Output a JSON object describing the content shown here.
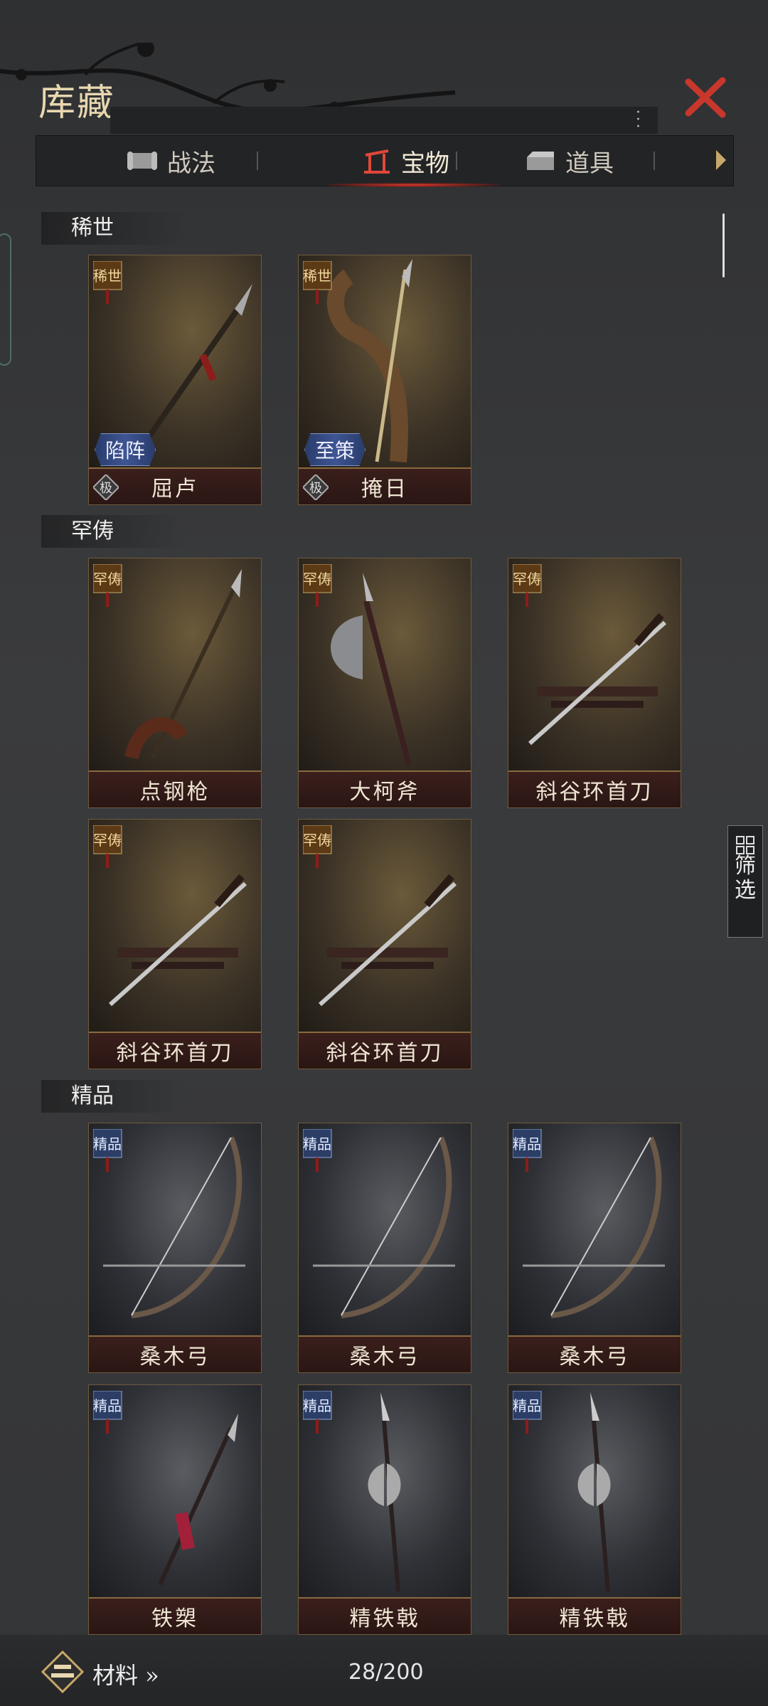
{
  "header": {
    "title": "库藏"
  },
  "tabs": [
    {
      "label": "战法",
      "icon": "scroll-icon"
    },
    {
      "label": "宝物",
      "icon": "treasure-icon",
      "active": true
    },
    {
      "label": "道具",
      "icon": "chest-icon"
    }
  ],
  "sections": [
    {
      "title": "稀世",
      "badge": "稀世",
      "items": [
        {
          "name": "屈卢",
          "skill": "陷阵",
          "rank": "极"
        },
        {
          "name": "掩日",
          "skill": "至策",
          "rank": "极"
        }
      ]
    },
    {
      "title": "罕俦",
      "badge": "罕俦",
      "items": [
        {
          "name": "点钢枪"
        },
        {
          "name": "大柯斧"
        },
        {
          "name": "斜谷环首刀"
        },
        {
          "name": "斜谷环首刀"
        },
        {
          "name": "斜谷环首刀"
        }
      ]
    },
    {
      "title": "精品",
      "badge": "精品",
      "items": [
        {
          "name": "桑木弓"
        },
        {
          "name": "桑木弓"
        },
        {
          "name": "桑木弓"
        },
        {
          "name": "铁槊"
        },
        {
          "name": "精铁戟"
        },
        {
          "name": "精铁戟"
        }
      ]
    }
  ],
  "filter": {
    "label_1": "筛",
    "label_2": "选"
  },
  "footer": {
    "materials_label": "材料 »",
    "count": "28/200"
  },
  "colors": {
    "accent_red": "#e43a2c",
    "gold": "#c8a86a"
  }
}
